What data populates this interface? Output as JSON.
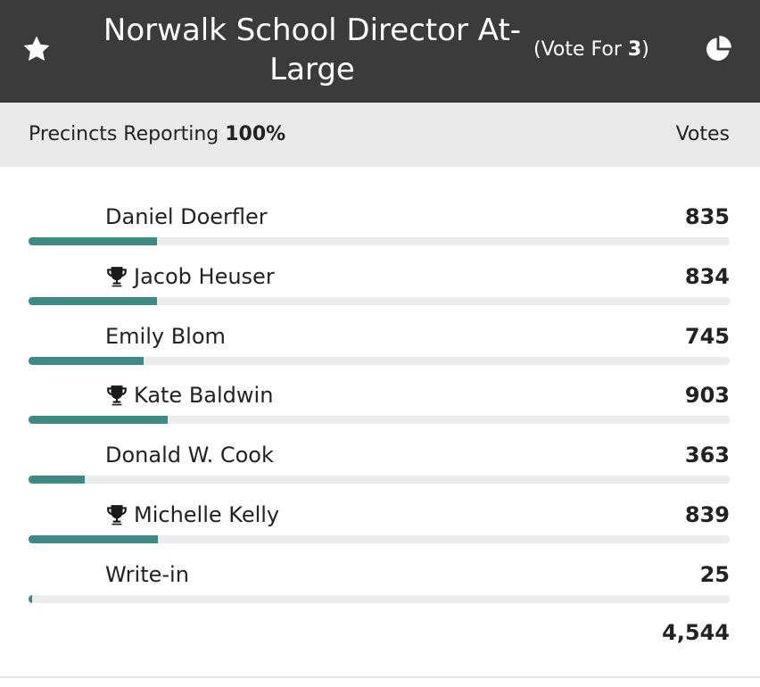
{
  "contest": {
    "title": "Norwalk School Director At-Large",
    "vote_for_prefix": "(Vote For ",
    "vote_for_count": "3",
    "vote_for_suffix": ")"
  },
  "summary": {
    "precincts_label": "Precincts Reporting ",
    "precincts_value": "100%",
    "votes_header": "Votes",
    "total_votes": "4,544"
  },
  "candidates": [
    {
      "name": "Daniel Doerfler",
      "votes": "835",
      "share": 0.1838,
      "winner": false
    },
    {
      "name": "Jacob Heuser",
      "votes": "834",
      "share": 0.1835,
      "winner": true
    },
    {
      "name": "Emily Blom",
      "votes": "745",
      "share": 0.164,
      "winner": false
    },
    {
      "name": "Kate Baldwin",
      "votes": "903",
      "share": 0.1987,
      "winner": true
    },
    {
      "name": "Donald W. Cook",
      "votes": "363",
      "share": 0.0799,
      "winner": false
    },
    {
      "name": "Michelle Kelly",
      "votes": "839",
      "share": 0.1846,
      "winner": true
    },
    {
      "name": "Write-in",
      "votes": "25",
      "share": 0.0055,
      "winner": false
    }
  ],
  "icons": {
    "favorite": "star-icon",
    "chart": "pie-chart-icon",
    "winner": "trophy-icon"
  },
  "colors": {
    "header_bg": "#3b3b3b",
    "subheader_bg": "#e9e9e9",
    "bar_fill": "#3f8a87",
    "bar_track": "#ececec"
  }
}
